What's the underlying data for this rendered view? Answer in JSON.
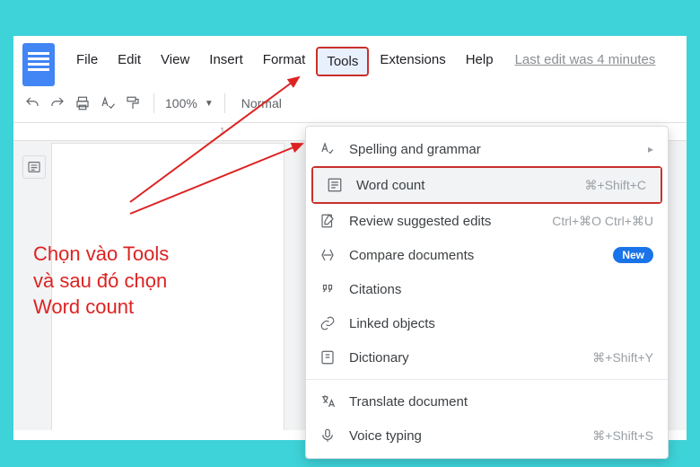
{
  "header": {
    "doc_title_fragment": "",
    "menu": {
      "file": "File",
      "edit": "Edit",
      "view": "View",
      "insert": "Insert",
      "format": "Format",
      "tools": "Tools",
      "extensions": "Extensions",
      "help": "Help"
    },
    "last_edit": "Last edit was 4 minutes"
  },
  "toolbar": {
    "zoom": "100%",
    "style": "Normal"
  },
  "ruler": {
    "mark1": "1"
  },
  "dropdown": {
    "spelling": {
      "label": "Spelling and grammar"
    },
    "wordcount": {
      "label": "Word count",
      "shortcut": "⌘+Shift+C"
    },
    "review": {
      "label": "Review suggested edits",
      "shortcut": "Ctrl+⌘O Ctrl+⌘U"
    },
    "compare": {
      "label": "Compare documents",
      "badge": "New"
    },
    "citations": {
      "label": "Citations"
    },
    "linked": {
      "label": "Linked objects"
    },
    "dictionary": {
      "label": "Dictionary",
      "shortcut": "⌘+Shift+Y"
    },
    "translate": {
      "label": "Translate document"
    },
    "voice": {
      "label": "Voice typing",
      "shortcut": "⌘+Shift+S"
    }
  },
  "annotation": {
    "line1": "Chọn vào Tools",
    "line2": "và sau đó chọn",
    "line3": "Word count"
  }
}
